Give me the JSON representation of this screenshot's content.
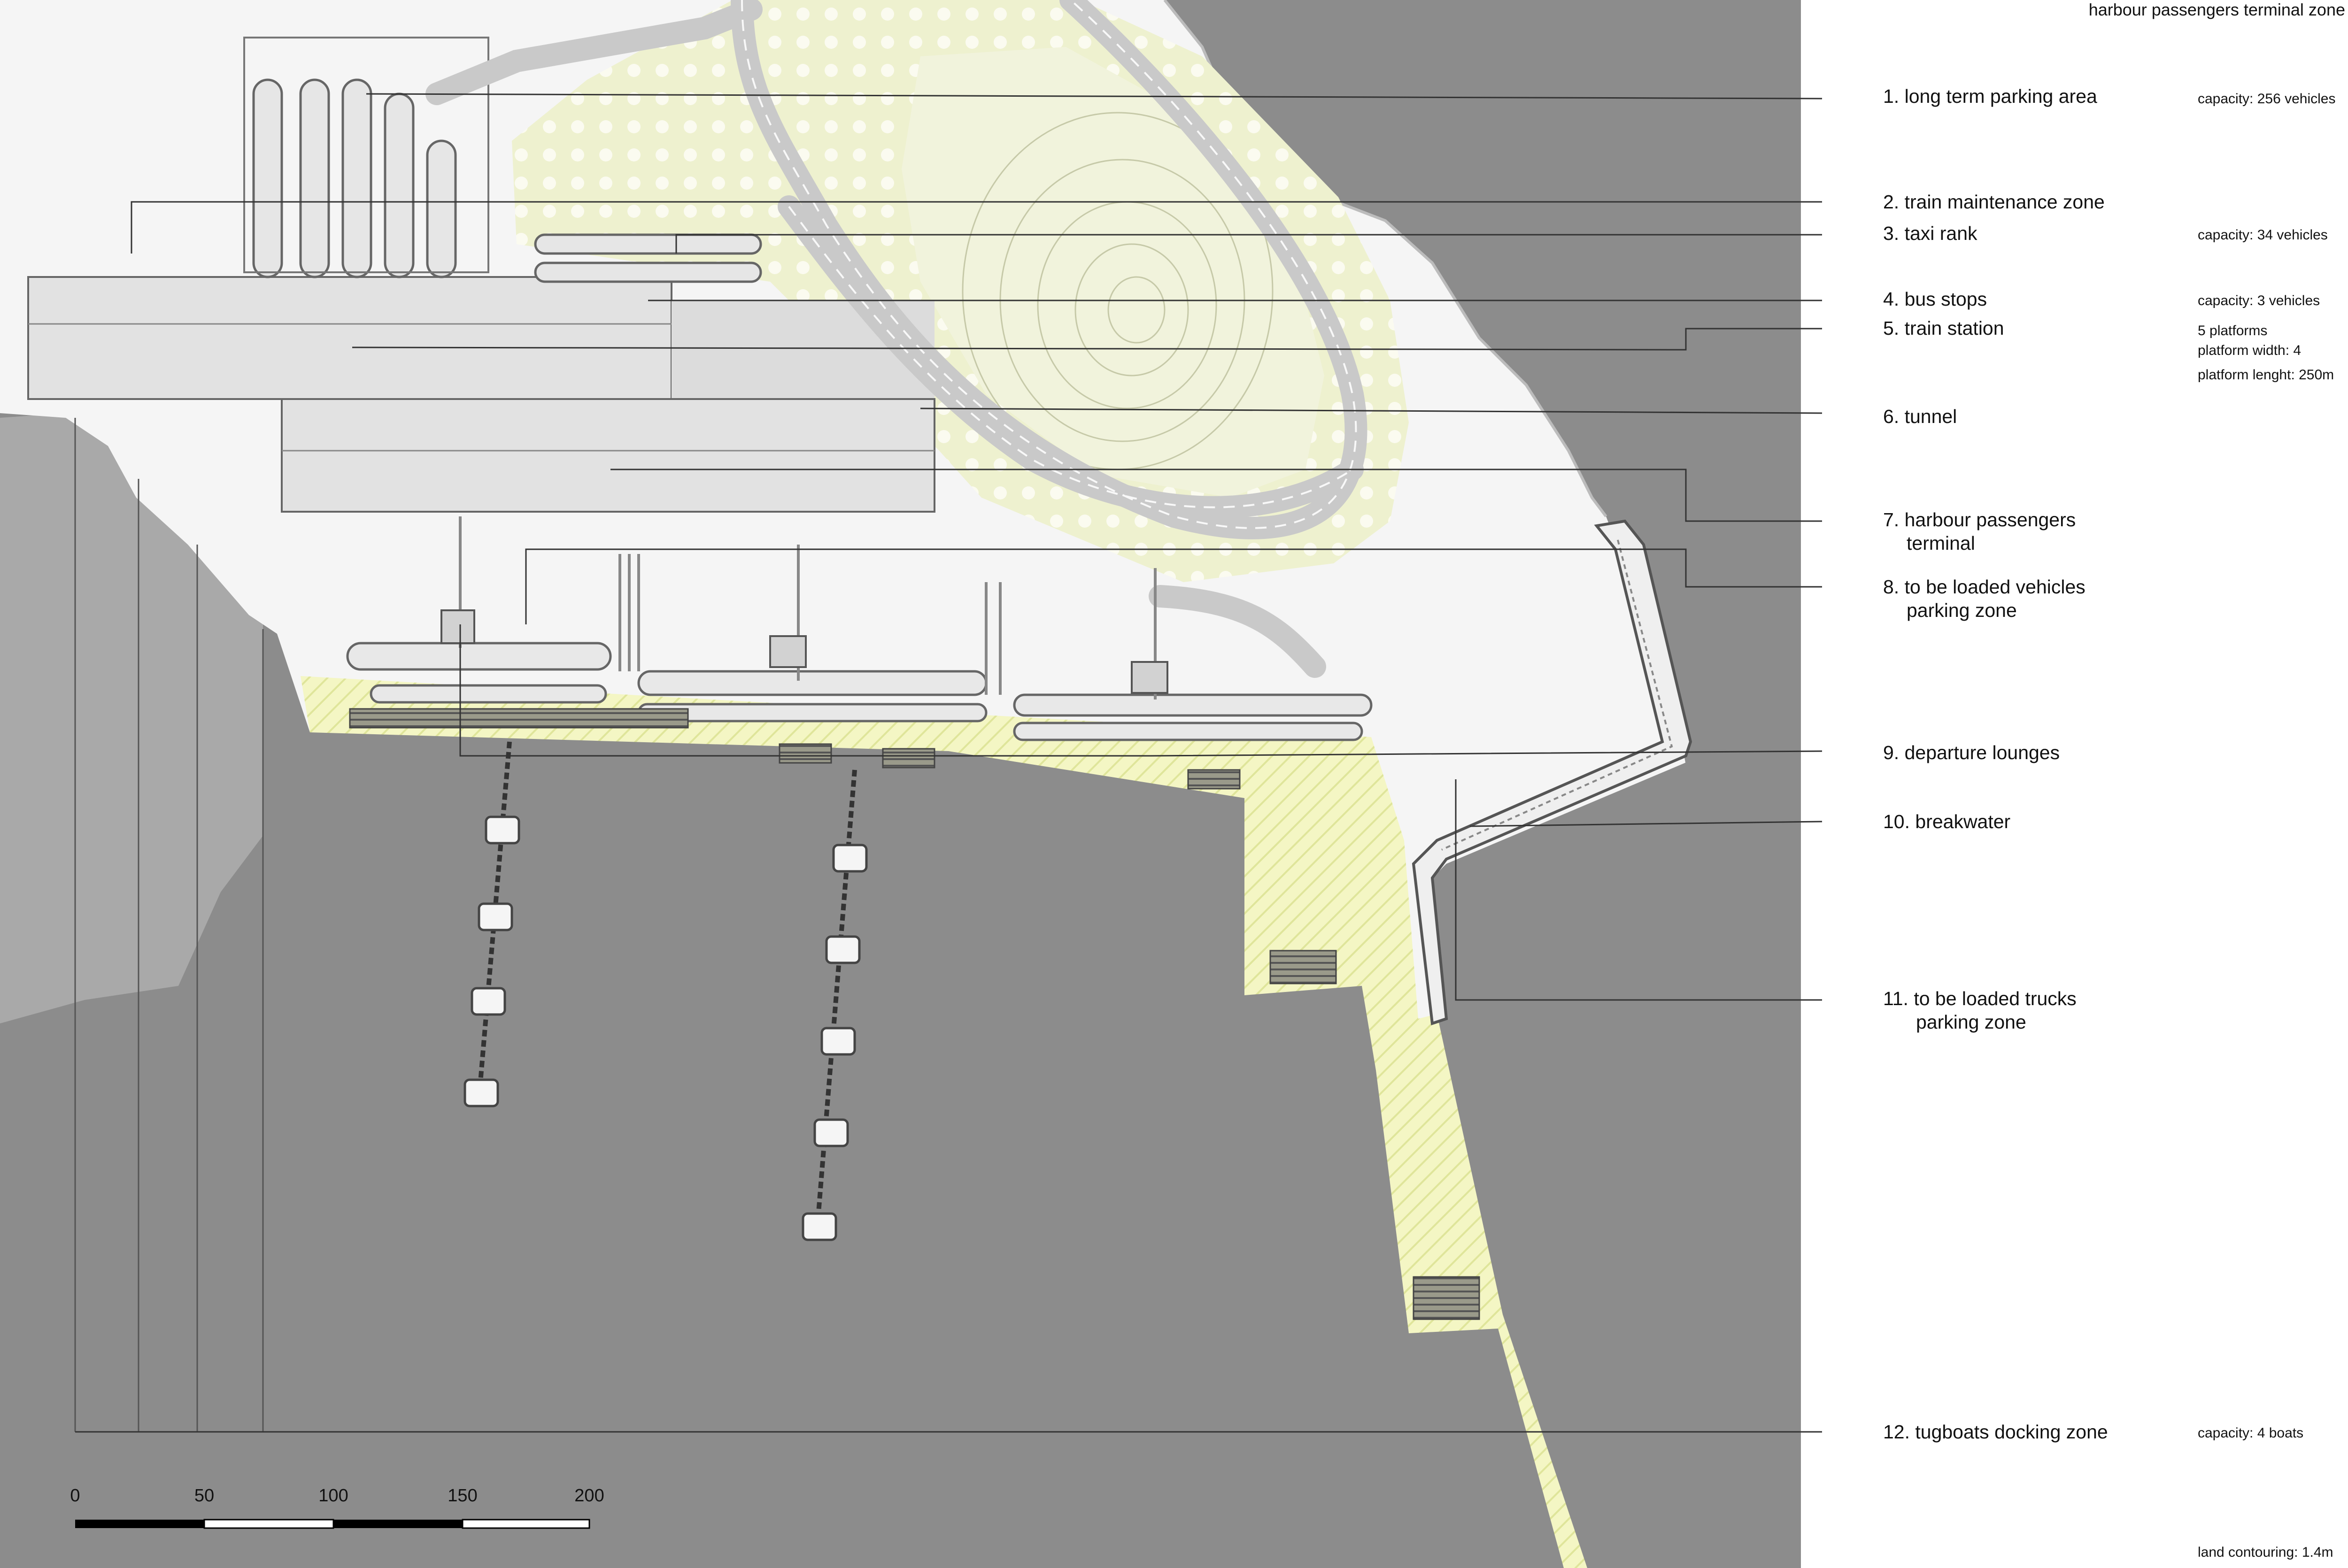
{
  "title": "harbour passengers terminal zone",
  "legend": [
    {
      "label": "1. long term parking area",
      "note": "capacity: 256 vehicles"
    },
    {
      "label": "2. train maintenance zone",
      "note": ""
    },
    {
      "label": "3. taxi rank",
      "note": "capacity: 34 vehicles"
    },
    {
      "label": "4. bus stops",
      "note": "capacity: 3 vehicles"
    },
    {
      "label": "5. train station",
      "note": "5 platforms",
      "note2": "platform width: 4",
      "note3": "platform lenght: 250m"
    },
    {
      "label": "6. tunnel",
      "note": ""
    },
    {
      "label": "7. harbour passengers",
      "label2": "terminal",
      "note": ""
    },
    {
      "label": "8. to be loaded vehicles",
      "label2": "parking zone",
      "note": ""
    },
    {
      "label": "9. departure lounges",
      "note": ""
    },
    {
      "label": "10. breakwater",
      "note": ""
    },
    {
      "label": "11. to be loaded trucks",
      "label2": "parking zone",
      "note": ""
    },
    {
      "label": "12. tugboats docking zone",
      "note": "capacity: 4 boats"
    }
  ],
  "scale_bar": {
    "ticks": [
      "0",
      "50",
      "100",
      "150",
      "200"
    ]
  },
  "footer": "land contouring: 1.4m",
  "colors": {
    "sea": "#8c8c8c",
    "land": "#f6f6f6",
    "green_area": "#eef2cf",
    "yellow_hatch": "#f2f4b8",
    "building": "#e4e4e4",
    "road": "#d6d6d6",
    "leader_line": "#333333"
  }
}
